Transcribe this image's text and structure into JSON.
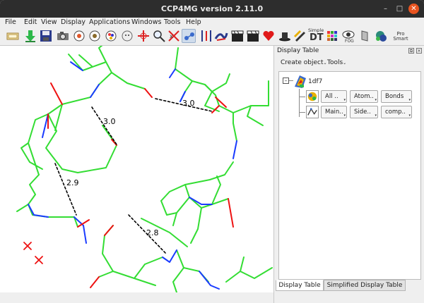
{
  "window": {
    "title": "CCP4MG version 2.11.0",
    "minimize_glyph": "–",
    "maximize_glyph": "□",
    "close_glyph": "✕"
  },
  "menubar": {
    "items": [
      "File",
      "Edit",
      "View",
      "Display",
      "Applications",
      "Windows",
      "Tools",
      "Help"
    ]
  },
  "toolbar": {
    "icons": [
      "open-file-icon",
      "load-icon",
      "save-icon",
      "camera-icon",
      "rotate-icon",
      "eye-icon",
      "color-icon",
      "face-icon",
      "center-icon",
      "zoom-icon",
      "crosshair-icon",
      "network-icon",
      "fit-icon",
      "ribbon-icon",
      "movie-icon",
      "clapper-icon",
      "heart-icon",
      "hat-icon",
      "fps-icon",
      "dt-icon",
      "abc-icon",
      "fog-eye-icon",
      "shield-icon",
      "globe-icon",
      "pro-smart-icon"
    ],
    "dt_label": "DT",
    "simple_dt_text": "Simple",
    "pro_smart_text": "Pro Smart",
    "active_colors": {
      "bg": "#cfdcec",
      "border": "#9ab0cc"
    }
  },
  "viewport": {
    "distances": [
      "3.0",
      "3.0",
      "2.9",
      "2.8"
    ],
    "colors": {
      "carbon": "#33dd33",
      "nitrogen": "#1a3bff",
      "oxygen": "#ee1111",
      "water": "#ee1111",
      "hbond": "#000000"
    }
  },
  "panel": {
    "title": "Display Table",
    "float_glyph": "⧉",
    "close_glyph": "✕",
    "menus": [
      "Create object",
      "Tools"
    ],
    "molecule": {
      "name": "1df7",
      "expander": "–",
      "rows": [
        [
          "All ..",
          "Atom..",
          "Bonds"
        ],
        [
          "Main..",
          "Side..",
          "comp.."
        ]
      ]
    },
    "tabs": [
      "Display Table",
      "Simplified Display Table"
    ]
  }
}
